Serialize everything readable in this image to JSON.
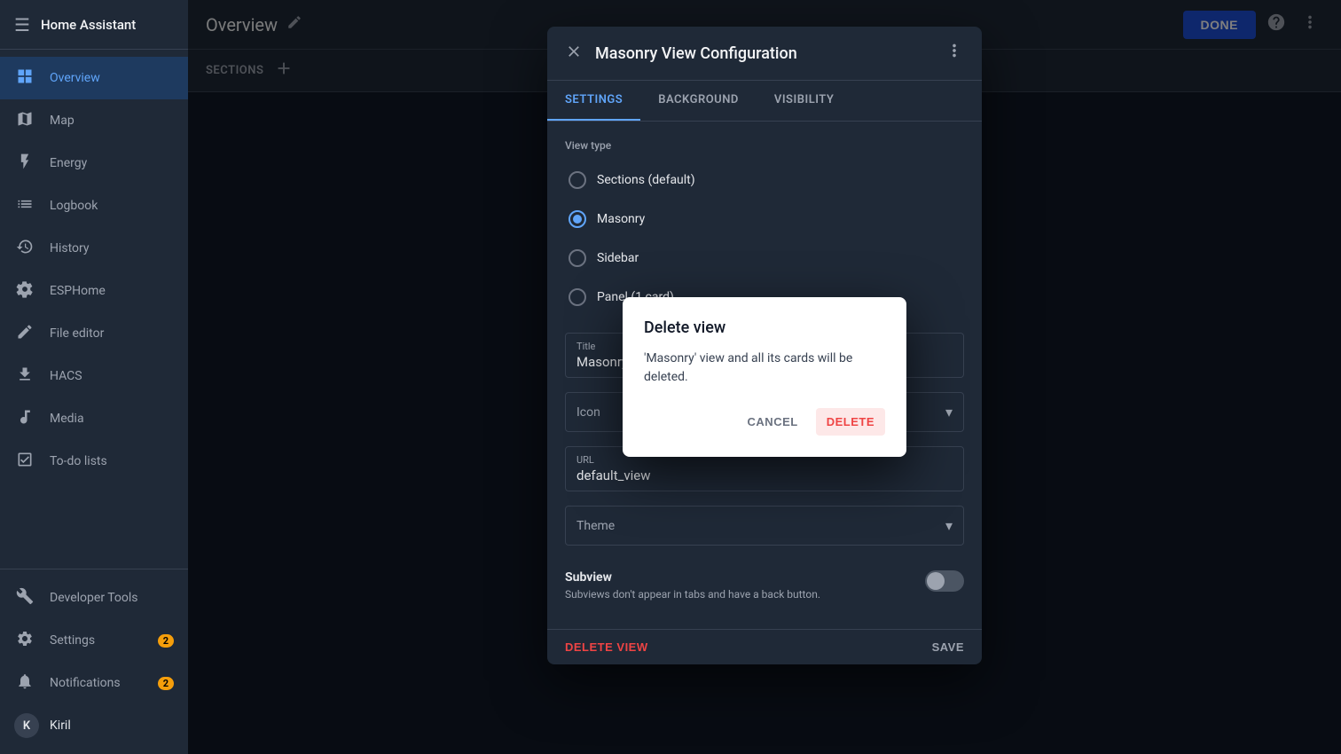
{
  "app": {
    "title": "Home Assistant"
  },
  "sidebar": {
    "menu_icon": "☰",
    "title": "Home Assistant",
    "nav_items": [
      {
        "id": "overview",
        "label": "Overview",
        "icon": "⊞",
        "active": true,
        "badge": null
      },
      {
        "id": "map",
        "label": "Map",
        "icon": "◎",
        "active": false,
        "badge": null
      },
      {
        "id": "energy",
        "label": "Energy",
        "icon": "⚡",
        "active": false,
        "badge": null
      },
      {
        "id": "logbook",
        "label": "Logbook",
        "icon": "≡",
        "active": false,
        "badge": null
      },
      {
        "id": "history",
        "label": "History",
        "icon": "📈",
        "active": false,
        "badge": null
      },
      {
        "id": "esphome",
        "label": "ESPHome",
        "icon": "⚙",
        "active": false,
        "badge": null
      },
      {
        "id": "file-editor",
        "label": "File editor",
        "icon": "✏",
        "active": false,
        "badge": null
      },
      {
        "id": "hacs",
        "label": "HACS",
        "icon": "⬇",
        "active": false,
        "badge": null
      },
      {
        "id": "media",
        "label": "Media",
        "icon": "▶",
        "active": false,
        "badge": null
      },
      {
        "id": "todo-lists",
        "label": "To-do lists",
        "icon": "☑",
        "active": false,
        "badge": null
      }
    ],
    "bottom_items": [
      {
        "id": "developer-tools",
        "label": "Developer Tools",
        "icon": "🔧",
        "badge": null
      },
      {
        "id": "settings",
        "label": "Settings",
        "icon": "⚙",
        "badge": "2"
      },
      {
        "id": "notifications",
        "label": "Notifications",
        "icon": "🔔",
        "badge": "2"
      }
    ],
    "user": {
      "initial": "K",
      "name": "Kiril"
    }
  },
  "topbar": {
    "title": "Overview",
    "edit_icon": "✏",
    "done_label": "DONE",
    "help_icon": "?",
    "more_icon": "⋮"
  },
  "sections_bar": {
    "label": "SECTIONS",
    "add_icon": "+"
  },
  "config_dialog": {
    "title": "Masonry View Configuration",
    "close_icon": "✕",
    "more_icon": "⋮",
    "tabs": [
      {
        "id": "settings",
        "label": "SETTINGS",
        "active": true
      },
      {
        "id": "background",
        "label": "BACKGROUND",
        "active": false
      },
      {
        "id": "visibility",
        "label": "VISIBILITY",
        "active": false
      }
    ],
    "view_type_label": "View type",
    "radio_options": [
      {
        "id": "sections",
        "label": "Sections (default)",
        "selected": false
      },
      {
        "id": "masonry",
        "label": "Masonry",
        "selected": true
      },
      {
        "id": "sidebar",
        "label": "Sidebar",
        "selected": false
      },
      {
        "id": "panel",
        "label": "Panel (1 card)",
        "selected": false
      }
    ],
    "title_field": {
      "label": "Title",
      "value": "Masonry"
    },
    "icon_field": {
      "label": "Icon",
      "placeholder": "Icon"
    },
    "url_field": {
      "label": "URL",
      "value": "default_view"
    },
    "theme_field": {
      "label": "Theme",
      "placeholder": "Theme"
    },
    "subview": {
      "title": "Subview",
      "description": "Subviews don't appear in tabs and have a back button.",
      "enabled": false
    },
    "delete_view_label": "DELETE VIEW",
    "save_label": "SAVE"
  },
  "delete_dialog": {
    "title": "Delete view",
    "message": "'Masonry' view and all its cards will be deleted.",
    "cancel_label": "CANCEL",
    "delete_label": "DELETE"
  }
}
